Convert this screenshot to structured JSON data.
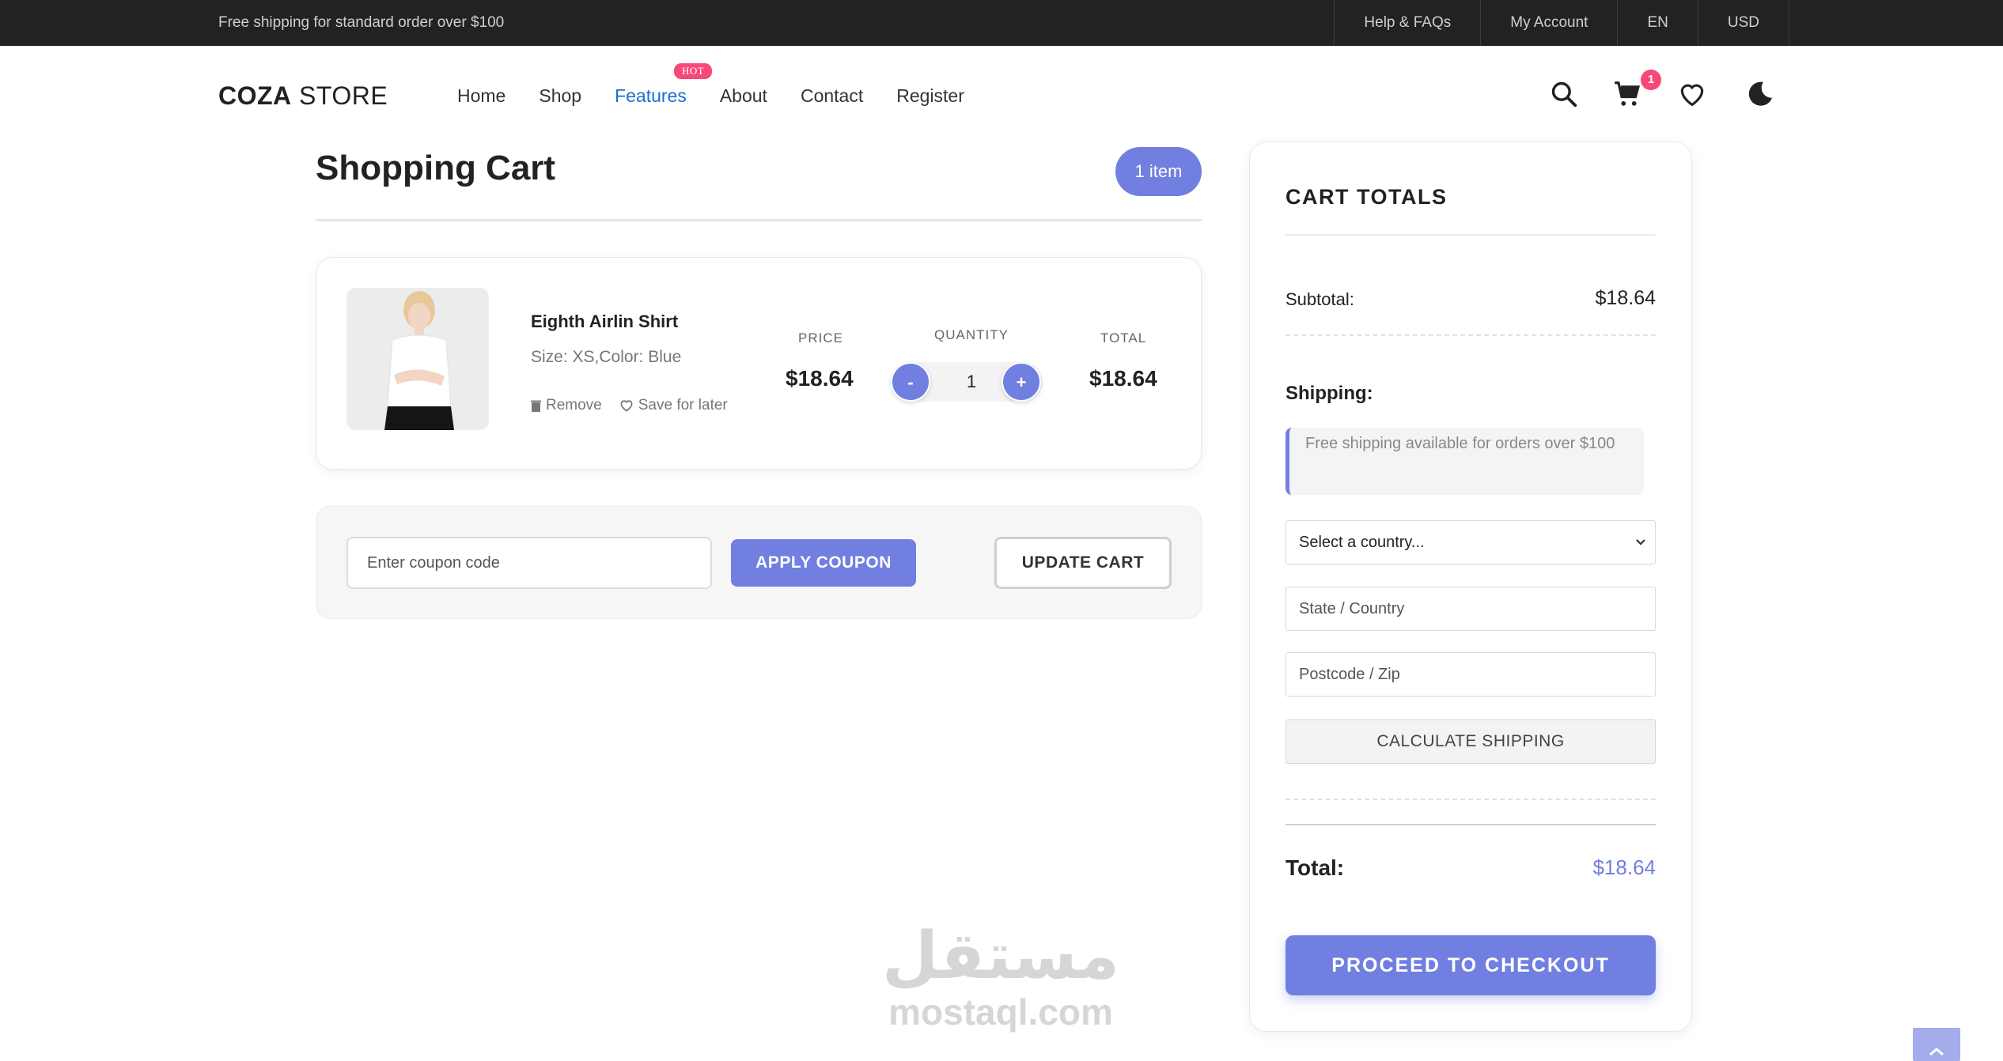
{
  "topbar": {
    "promo": "Free shipping for standard order over $100",
    "links": [
      "Help & FAQs",
      "My Account",
      "EN",
      "USD"
    ]
  },
  "header": {
    "logo_bold": "COZA",
    "logo_light": " STORE",
    "nav": [
      "Home",
      "Shop",
      "Features",
      "About",
      "Contact",
      "Register"
    ],
    "active_nav": "Features",
    "hot_badge": "HOT",
    "cart_count": "1",
    "icons": [
      "search-icon",
      "cart-icon",
      "heart-icon",
      "moon-icon"
    ]
  },
  "cart": {
    "title": "Shopping Cart",
    "item_count": "1 item",
    "columns": {
      "price": "PRICE",
      "quantity": "QUANTITY",
      "total": "TOTAL"
    },
    "item": {
      "name": "Eighth Airlin Shirt",
      "variant": "Size: XS,Color: Blue",
      "remove_label": "Remove",
      "save_label": "Save for later",
      "price": "$18.64",
      "quantity": "1",
      "minus": "-",
      "plus": "+",
      "total": "$18.64"
    },
    "coupon_placeholder": "Enter coupon code",
    "apply_label": "APPLY COUPON",
    "update_label": "UPDATE CART"
  },
  "totals": {
    "title": "CART TOTALS",
    "subtotal_label": "Subtotal:",
    "subtotal_value": "$18.64",
    "shipping_label": "Shipping:",
    "shipping_note": "Free shipping available for orders over $100",
    "country_select": "Select a country...",
    "state_placeholder": "State / Country",
    "postcode_placeholder": "Postcode / Zip",
    "calculate_label": "CALCULATE SHIPPING",
    "total_label": "Total:",
    "total_value": "$18.64",
    "checkout_label": "PROCEED TO CHECKOUT"
  },
  "watermark": {
    "arabic": "مستقل",
    "latin": "mostaql.com"
  },
  "colors": {
    "accent": "#717fe0",
    "badge": "#f74877",
    "active_link": "#1a6fd0",
    "topbar": "#222222"
  }
}
